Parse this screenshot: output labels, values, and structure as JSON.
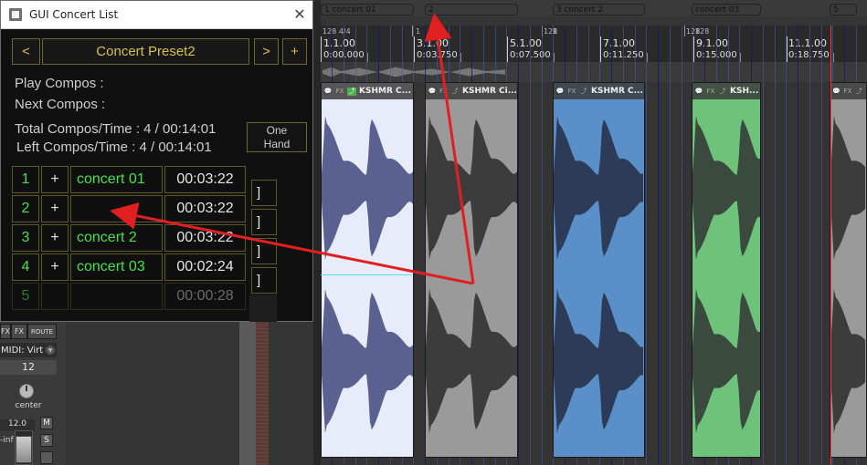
{
  "window": {
    "title": "GUI Concert List",
    "preset_name": "Concert Preset2",
    "prev_label": "<",
    "next_label": ">",
    "add_label": "+",
    "play_compos_label": "Play Compos :",
    "next_compos_label": "Next Compos :",
    "total_label": "Total Compos/Time : 4 / 00:14:01",
    "left_label": "Left Compos/Time  : 4 / 00:14:01",
    "one_hand_line1": "One",
    "one_hand_line2": "Hand",
    "rows": [
      {
        "num": "1",
        "plus": "+",
        "name": "concert 01",
        "time": "00:03:22",
        "bracket": "]"
      },
      {
        "num": "2",
        "plus": "+",
        "name": "",
        "time": "00:03:22",
        "bracket": "]"
      },
      {
        "num": "3",
        "plus": "+",
        "name": "concert 2",
        "time": "00:03:22",
        "bracket": "]"
      },
      {
        "num": "4",
        "plus": "+",
        "name": "concert 03",
        "time": "00:02:24",
        "bracket": "]"
      },
      {
        "num": "5",
        "plus": "",
        "name": "",
        "time": "00:00:28",
        "bracket": ""
      }
    ]
  },
  "regions": [
    {
      "label": "1  concert 01",
      "color": "#3b4fd6"
    },
    {
      "label": "2",
      "color": "#8a8f8a"
    },
    {
      "label": "3  concert 2",
      "color": "#5a8fd0"
    },
    {
      "label": "concert 03",
      "color": "#3fbf5a"
    },
    {
      "label": "5",
      "color": "#9a9a9a"
    }
  ],
  "ruler": {
    "time_sig": "128 4/4",
    "tempo_markers": [
      "1",
      "128",
      "1",
      "128",
      "1",
      "128"
    ],
    "bars": [
      {
        "bar": "1.1.00",
        "time": "0:00.000"
      },
      {
        "bar": "3.1.00",
        "time": "0:03.750"
      },
      {
        "bar": "5.1.00",
        "time": "0:07.500"
      },
      {
        "bar": "7.1.00",
        "time": "0:11.250"
      },
      {
        "bar": "9.1.00",
        "time": "0:15.000"
      },
      {
        "bar": "11.1.00",
        "time": "0:18.750"
      }
    ]
  },
  "items": [
    {
      "name": "KSHMR C...",
      "color": "#e8ecfa",
      "wave": "#5a6090"
    },
    {
      "name": "KSHMR Ci...",
      "color": "#9a9a9a",
      "wave": "#3c3c3c"
    },
    {
      "name": "KSHMR C...",
      "color": "#5a8fc8",
      "wave": "#2c3c58"
    },
    {
      "name": "KSH...",
      "color": "#6fc27a",
      "wave": "#3a4a3e"
    },
    {
      "name": "",
      "color": "#9a9a9a",
      "wave": "#3c3c3c"
    }
  ],
  "item_icons": {
    "notes": "💬",
    "fx": "FX",
    "env": "⤴"
  },
  "mixer": {
    "fx_label": "FX",
    "fx2_label": "FX",
    "route_label": "ROUTE",
    "midi_input": "MIDI: Virt",
    "channel": "12",
    "pan_label": "center",
    "vol_value": "12.0",
    "vol_inf": "-inf",
    "m_label": "M",
    "s_label": "S"
  },
  "colors": {
    "gold": "#d6c24c",
    "green_text": "#4be04b",
    "arrow_red": "#e02020"
  }
}
